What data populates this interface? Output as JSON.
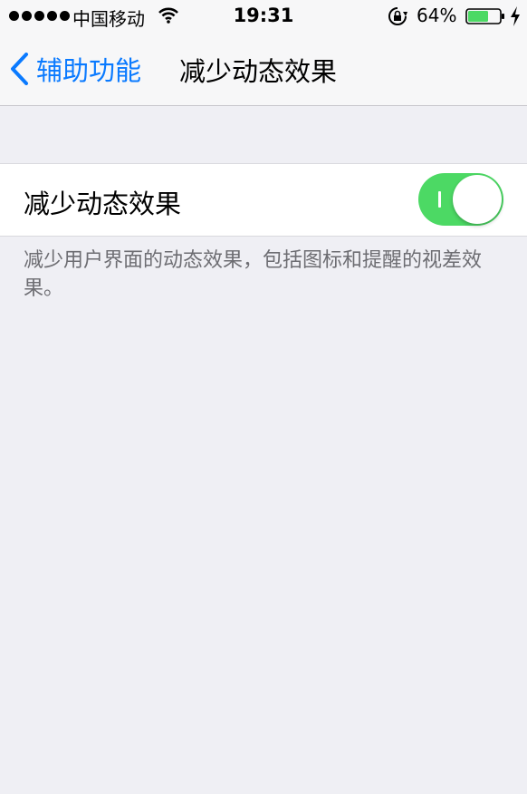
{
  "status_bar": {
    "carrier": "中国移动",
    "time": "19:31",
    "battery_percent": "64%",
    "battery_level": 0.64,
    "signal_bars": 5,
    "icons": [
      "signal-dots-icon",
      "wifi-icon",
      "rotation-lock-icon",
      "battery-icon",
      "charging-bolt-icon"
    ]
  },
  "nav_bar": {
    "back_label": "辅助功能",
    "title": "减少动态效果"
  },
  "settings": {
    "row_label": "减少动态效果",
    "toggle_on": true,
    "description": "减少用户界面的动态效果，包括图标和提醒的视差效果。"
  },
  "colors": {
    "accent": "#0a7aff",
    "toggle_on": "#4cd964",
    "background": "#efeff4"
  }
}
